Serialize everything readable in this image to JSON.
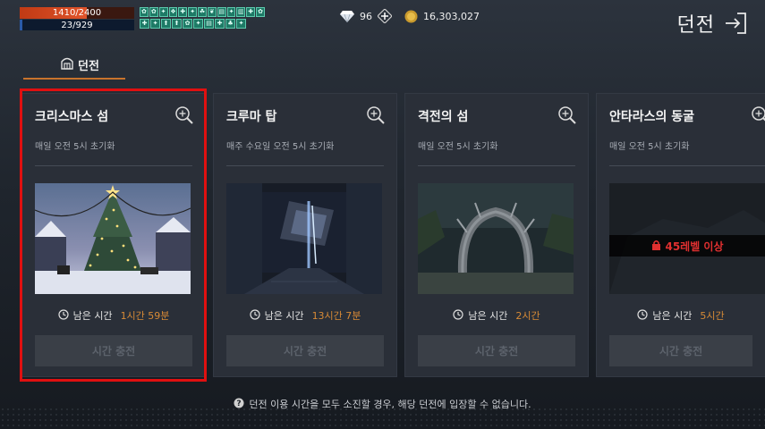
{
  "status": {
    "hp_text": "1410/2400",
    "hp_ratio": 0.5875,
    "mp_text": "23/929",
    "mp_ratio": 0.025
  },
  "buffs": {
    "row1": [
      "✿",
      "✿",
      "✦",
      "❖",
      "✚",
      "✦",
      "☘",
      "❦",
      "▤",
      "✦",
      "▥",
      "✚",
      "✿"
    ],
    "row2": [
      "✚",
      "✦",
      "⬆",
      "⬆",
      "✿",
      "✦",
      "▤",
      "✚",
      "♣",
      "✦"
    ]
  },
  "currency": {
    "gems": "96",
    "gold": "16,303,027"
  },
  "header": {
    "title": "던전"
  },
  "tab": {
    "label": "던전"
  },
  "cards": [
    {
      "title": "크리스마스 섬",
      "reset": "매일 오전 5시 초기화",
      "time_label": "남은 시간",
      "time_value": "1시간 59분",
      "button": "시간 충전"
    },
    {
      "title": "크루마 탑",
      "reset": "매주 수요일 오전 5시 초기화",
      "time_label": "남은 시간",
      "time_value": "13시간 7분",
      "button": "시간 충전"
    },
    {
      "title": "격전의 섬",
      "reset": "매일 오전 5시 초기화",
      "time_label": "남은 시간",
      "time_value": "2시간",
      "button": "시간 충전"
    },
    {
      "title": "안타라스의 동굴",
      "reset": "매일 오전 5시 초기화",
      "time_label": "남은 시간",
      "time_value": "5시간",
      "button": "시간 충전",
      "lock": "45레벨 이상"
    }
  ],
  "footer": {
    "note": "던전 이용 시간을 모두 소진할 경우, 해당 던전에 입장할 수 없습니다."
  },
  "colors": {
    "accent": "#c8732c",
    "time_value": "#d78a36",
    "selected": "#e01010",
    "lock": "#e03030"
  }
}
